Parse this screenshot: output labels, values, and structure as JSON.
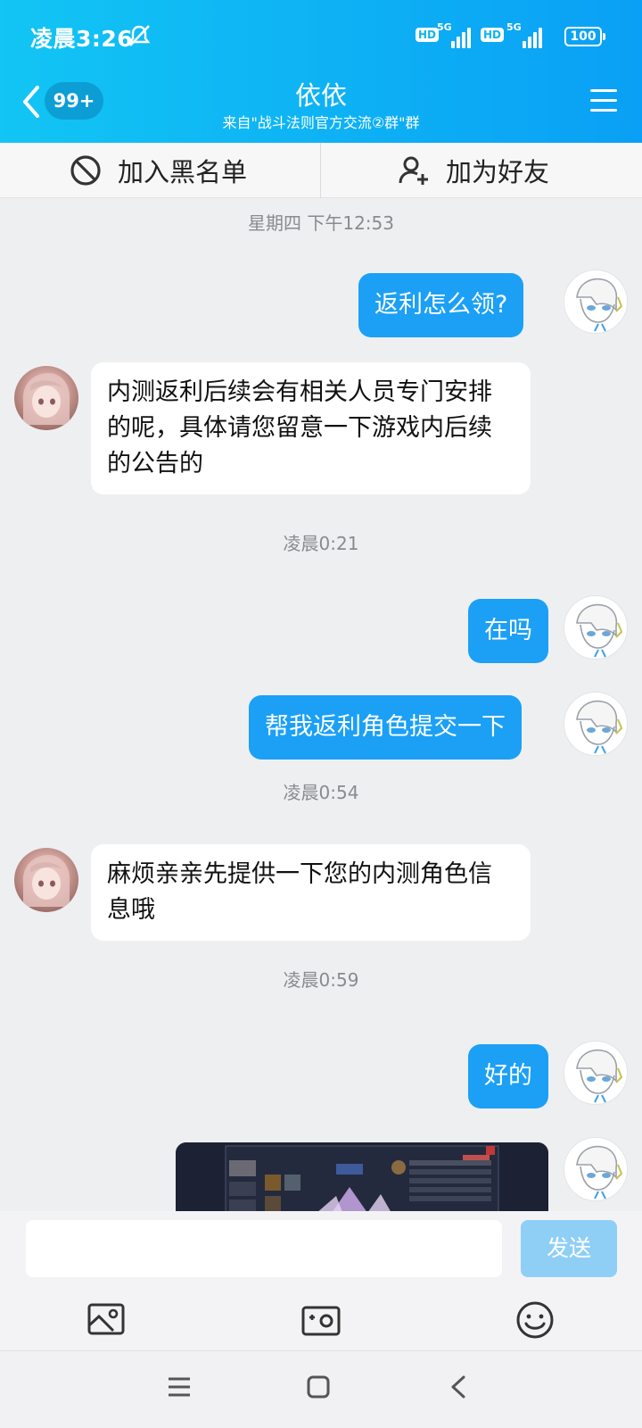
{
  "status_bar": {
    "time": "凌晨3:26",
    "hd1": "HD",
    "net1": "5G",
    "hd2": "HD",
    "net2": "5G",
    "battery": "100"
  },
  "header": {
    "badge": "99+",
    "title": "依依",
    "subtitle": "来自\"战斗法则官方交流②群\"群"
  },
  "actions": {
    "blacklist": "加入黑名单",
    "add_friend": "加为好友"
  },
  "messages": [
    {
      "type": "timestamp",
      "text": "星期四 下午12:53"
    },
    {
      "type": "out",
      "text": "返利怎么领?"
    },
    {
      "type": "in",
      "text": "内测返利后续会有相关人员专门安排的呢，具体请您留意一下游戏内后续的公告的"
    },
    {
      "type": "timestamp",
      "text": "凌晨0:21"
    },
    {
      "type": "out",
      "text": "在吗"
    },
    {
      "type": "out",
      "text": "帮我返利角色提交一下"
    },
    {
      "type": "timestamp",
      "text": "凌晨0:54"
    },
    {
      "type": "in",
      "text": "麻烦亲亲先提供一下您的内测角色信息哦"
    },
    {
      "type": "timestamp",
      "text": "凌晨0:59"
    },
    {
      "type": "out",
      "text": "好的"
    },
    {
      "type": "out_image",
      "text": ""
    }
  ],
  "input": {
    "placeholder": "",
    "send_label": "发送"
  },
  "colors": {
    "header_start": "#12c5f4",
    "header_end": "#0aa0f5",
    "bubble_out": "#1ba0f6",
    "send_disabled": "#8fcff6"
  },
  "icons": [
    "back-icon",
    "menu-icon",
    "block-icon",
    "add-user-icon",
    "image-icon",
    "camera-icon",
    "emoji-icon",
    "nav-menu-icon",
    "nav-home-icon",
    "nav-back-icon"
  ]
}
